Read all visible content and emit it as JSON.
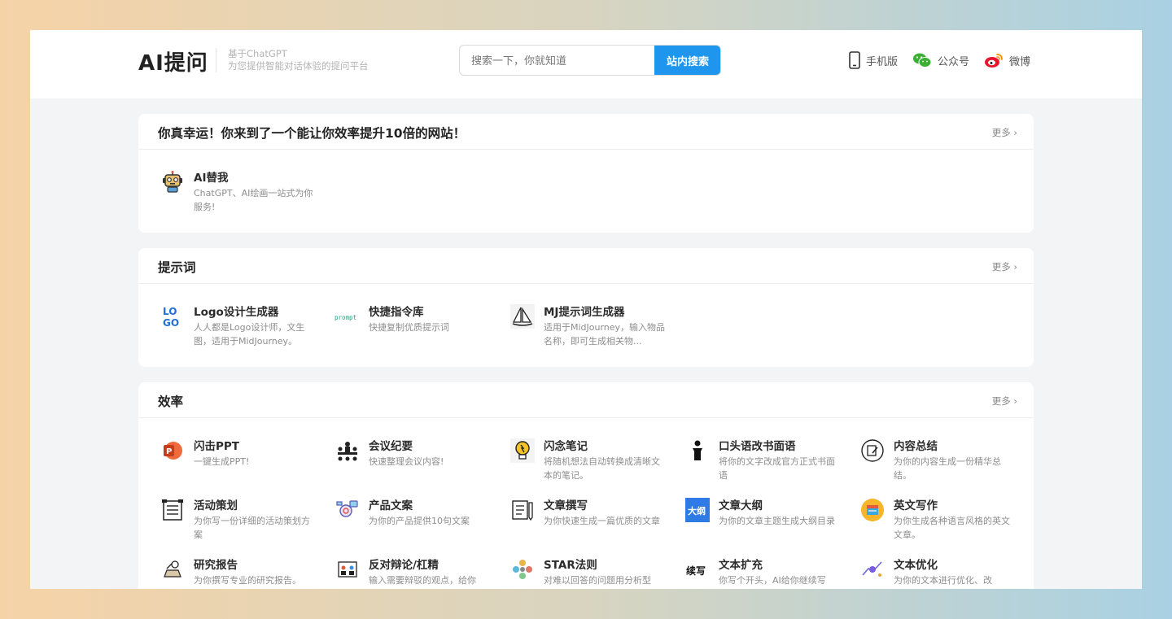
{
  "header": {
    "logo": "AI提问",
    "tagline_line1": "基于ChatGPT",
    "tagline_line2": "为您提供智能对话体验的提问平台",
    "search_placeholder": "搜索一下，你就知道",
    "search_button": "站内搜索",
    "links": [
      {
        "label": "手机版",
        "icon": "mobile-icon"
      },
      {
        "label": "公众号",
        "icon": "wechat-icon"
      },
      {
        "label": "微博",
        "icon": "weibo-icon"
      }
    ]
  },
  "sections": [
    {
      "title": "你真幸运！你来到了一个能让你效率提升10倍的网站！",
      "more": "更多 ›",
      "items": [
        {
          "title": "AI替我",
          "desc": "ChatGPT、AI绘画一站式为你服务!",
          "icon": "robot-icon"
        }
      ]
    },
    {
      "title": "提示词",
      "more": "更多 ›",
      "items": [
        {
          "title": "Logo设计生成器",
          "desc": "人人都是Logo设计师，文生图，适用于MidJourney。",
          "icon": "logo-icon"
        },
        {
          "title": "快捷指令库",
          "desc": "快捷复制优质提示词",
          "icon": "prompt-icon"
        },
        {
          "title": "MJ提示词生成器",
          "desc": "适用于MidJourney，输入物品名称，即可生成相关物...",
          "icon": "sailboat-icon"
        }
      ]
    },
    {
      "title": "效率",
      "more": "更多 ›",
      "items": [
        {
          "title": "闪击PPT",
          "desc": "一键生成PPT!",
          "icon": "powerpoint-icon"
        },
        {
          "title": "会议纪要",
          "desc": "快速整理会议内容!",
          "icon": "meeting-icon"
        },
        {
          "title": "闪念笔记",
          "desc": "将随机想法自动转换成清晰文本的笔记。",
          "icon": "lightbulb-icon"
        },
        {
          "title": "口头语改书面语",
          "desc": "将你的文字改成官方正式书面语",
          "icon": "speaker-icon"
        },
        {
          "title": "内容总结",
          "desc": "为你的内容生成一份精华总结。",
          "icon": "summary-icon"
        },
        {
          "title": "活动策划",
          "desc": "为你写一份详细的活动策划方案",
          "icon": "plan-icon"
        },
        {
          "title": "产品文案",
          "desc": "为你的产品提供10句文案",
          "icon": "product-icon"
        },
        {
          "title": "文章撰写",
          "desc": "为你快速生成一篇优质的文章",
          "icon": "article-icon"
        },
        {
          "title": "文章大纲",
          "desc": "为你的文章主题生成大纲目录",
          "icon": "outline-icon"
        },
        {
          "title": "英文写作",
          "desc": "为你生成各种语言风格的英文文章。",
          "icon": "english-icon"
        },
        {
          "title": "研究报告",
          "desc": "为你撰写专业的研究报告。",
          "icon": "research-icon"
        },
        {
          "title": "反对辩论/杠精",
          "desc": "输入需要辩驳的观点，给你",
          "icon": "debate-icon"
        },
        {
          "title": "STAR法则",
          "desc": "对难以回答的问题用分析型",
          "icon": "star-icon"
        },
        {
          "title": "文本扩充",
          "desc": "你写个开头，AI给你继续写",
          "icon": "expand-icon"
        },
        {
          "title": "文本优化",
          "desc": "为你的文本进行优化、改",
          "icon": "optimize-icon"
        }
      ]
    }
  ],
  "icon_text": {
    "logo_l": "LO",
    "logo_g": "GO",
    "prompt": "prompt",
    "outline": "大纲",
    "expand": "续写"
  }
}
